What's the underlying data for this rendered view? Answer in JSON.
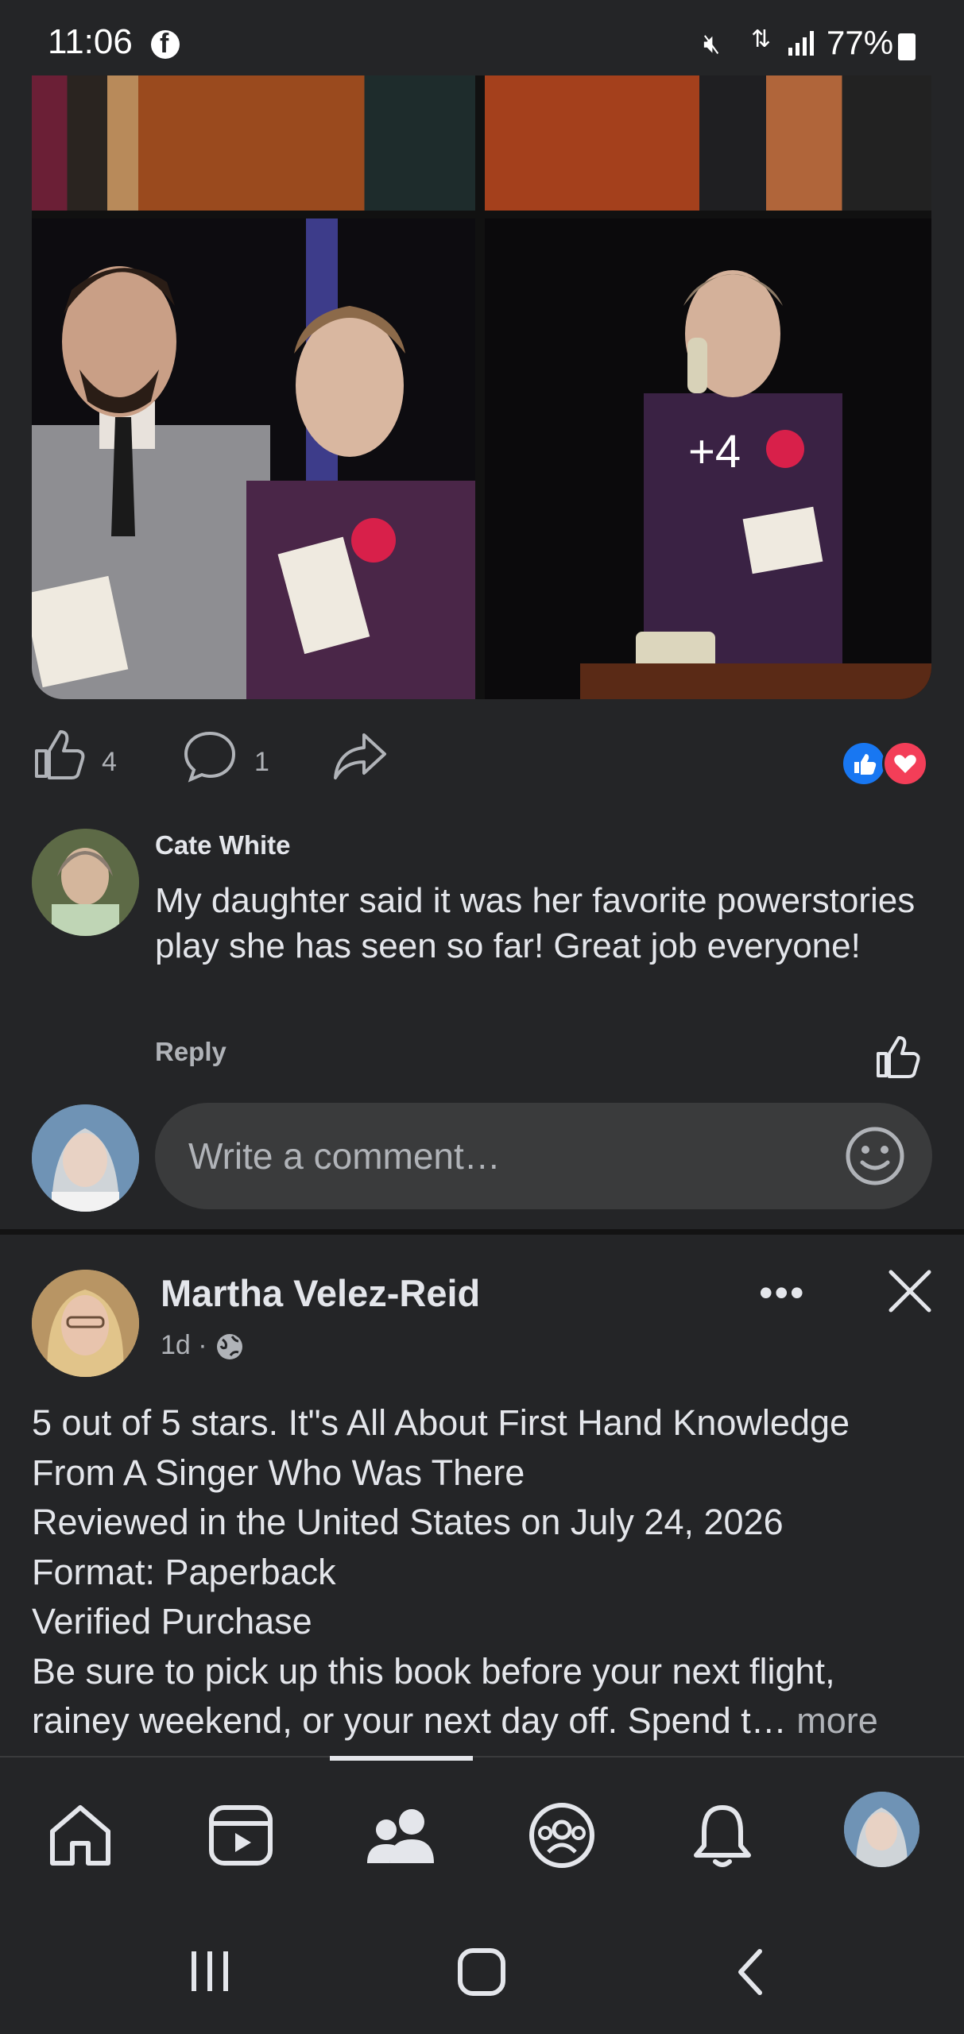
{
  "status_bar": {
    "time": "11:06",
    "battery": "77%"
  },
  "photo_grid": {
    "more_count": "+4"
  },
  "post1_actions": {
    "like_count": "4",
    "comment_count": "1"
  },
  "comment": {
    "author": "Cate White",
    "text": "My daughter said it was her favorite powerstories play she has seen so far! Great job everyone!",
    "reply_label": "Reply"
  },
  "composer": {
    "placeholder": "Write a comment…"
  },
  "post2": {
    "author": "Martha Velez-Reid",
    "time": "1d",
    "more_options": "•••",
    "body_lines": [
      "5 out of 5 stars. It\"s All About First Hand Knowledge",
      "From A Singer Who Was There",
      "Reviewed in the United States on July 24, 2026",
      "Format: Paperback",
      "Verified Purchase",
      "Be sure to pick up this book before your next flight,",
      "rainey weekend, or your next day off. Spend t… "
    ],
    "more_label": "more"
  },
  "colors": {
    "background": "#242527",
    "text": "#e4e6eb",
    "muted": "#b0b3b8",
    "like_blue": "#1877f2",
    "love_red": "#f33e58"
  },
  "icons": [
    "facebook-icon",
    "mute-icon",
    "signal-icon",
    "battery-icon",
    "like-icon",
    "comment-icon",
    "share-icon",
    "like-reaction-icon",
    "love-reaction-icon",
    "emoji-icon",
    "more-options-icon",
    "close-icon",
    "globe-icon",
    "home-icon",
    "video-icon",
    "friends-icon",
    "groups-icon",
    "bell-icon",
    "profile-avatar",
    "recents-icon",
    "home-button-icon",
    "back-icon"
  ]
}
